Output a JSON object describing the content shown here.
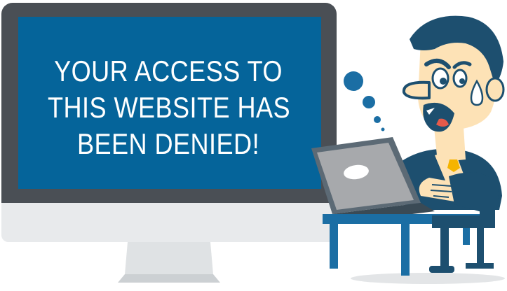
{
  "message": {
    "lines": [
      "YOUR ACCESS TO",
      "THIS WEBSITE HAS",
      "BEEN DENIED!"
    ]
  },
  "colors": {
    "screen_background": "#05649a",
    "monitor_bezel": "#4a4f55",
    "monitor_chin": "#e6e8ea",
    "stand": "#dfe2e4",
    "character_navy": "#1d4f6f",
    "thought_bubble": "#1b6ea4",
    "skin": "#fde2b6",
    "tie": "#f5b400",
    "laptop_lid": "#5c6a75",
    "laptop_screen": "#a7a9ac",
    "desk": "#1b6ea4",
    "shadow": "#dcdcdc"
  },
  "icons": {
    "character": "worried-man-icon",
    "laptop": "laptop-icon",
    "sweat": "sweat-drop-icon",
    "thought": "thought-bubble-icon"
  }
}
